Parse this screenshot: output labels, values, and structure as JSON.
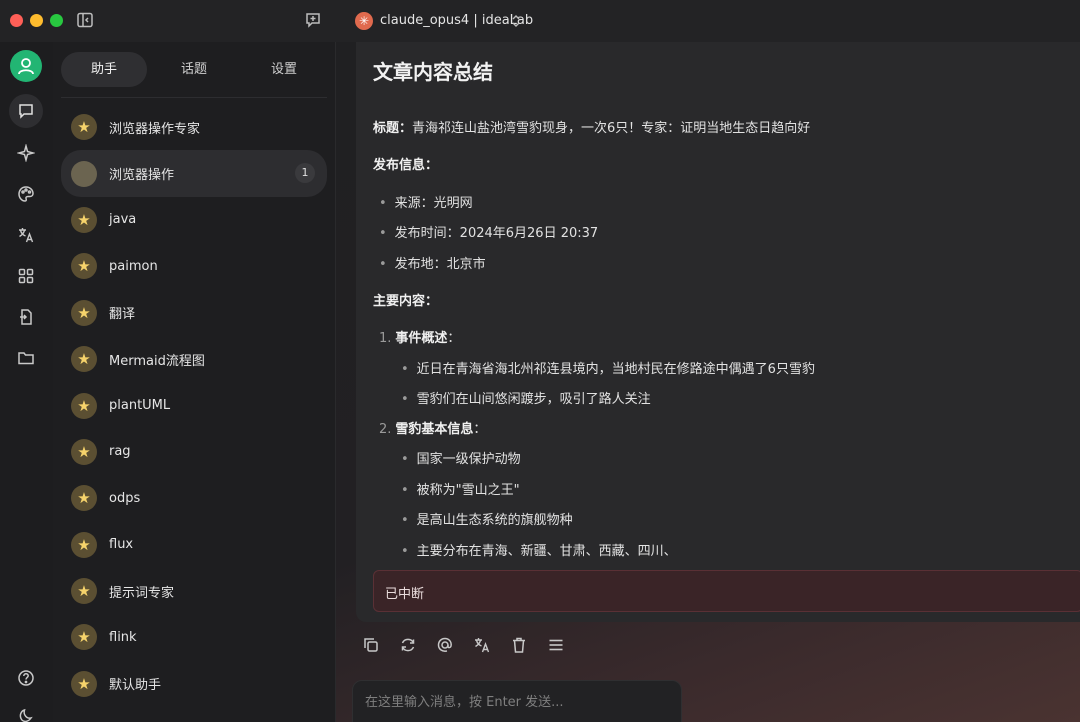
{
  "model": {
    "name": "claude_opus4 | ideaLab",
    "badge_glyph": "✳"
  },
  "tabs": [
    {
      "label": "助手"
    },
    {
      "label": "话题"
    },
    {
      "label": "设置"
    }
  ],
  "assistants": [
    {
      "label": "浏览器操作专家"
    },
    {
      "label": "浏览器操作",
      "count": "1"
    },
    {
      "label": "java"
    },
    {
      "label": "paimon"
    },
    {
      "label": "翻译"
    },
    {
      "label": "Mermaid流程图"
    },
    {
      "label": "plantUML"
    },
    {
      "label": "rag"
    },
    {
      "label": "odps"
    },
    {
      "label": "flux"
    },
    {
      "label": "提示词专家"
    },
    {
      "label": "flink"
    },
    {
      "label": "默认助手"
    }
  ],
  "message": {
    "title": "文章内容总结",
    "headline_label": "标题：",
    "headline": "青海祁连山盐池湾雪豹现身，一次6只！专家：证明当地生态日趋向好",
    "publish_label": "发布信息：",
    "publish": [
      "来源：光明网",
      "发布时间：2024年6月26日 20:37",
      "发布地：北京市"
    ],
    "main_label": "主要内容：",
    "sections": [
      {
        "num": "1.",
        "heading": "事件概述",
        "colon": "：",
        "points": [
          "近日在青海省海北州祁连县境内，当地村民在修路途中偶遇了6只雪豹",
          "雪豹们在山间悠闲踱步，吸引了路人关注"
        ]
      },
      {
        "num": "2.",
        "heading": "雪豹基本信息",
        "colon": "：",
        "points": [
          "国家一级保护动物",
          "被称为\"雪山之王\"",
          "是高山生态系统的旗舰物种",
          "主要分布在青海、新疆、甘肃、西藏、四川、"
        ]
      }
    ],
    "status": "已中断"
  },
  "input": {
    "placeholder": "在这里输入消息，按 Enter 发送..."
  },
  "colors": {
    "accent_green": "#22b573",
    "interrupt_bg": "#3a2427",
    "star": "#f6d36b"
  }
}
